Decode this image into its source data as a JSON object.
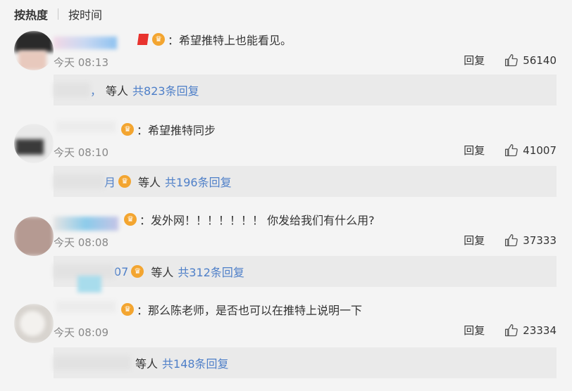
{
  "tabs": {
    "hot": "按热度",
    "time": "按时间"
  },
  "comments": [
    {
      "text": "：希望推特上也能看见。",
      "time": "今天 08:13",
      "reply_label": "回复",
      "likes": "56140",
      "sub": {
        "prefix": "，",
        "others": "等人",
        "link": "共823条回复"
      }
    },
    {
      "text": "：希望推特同步",
      "time": "今天 08:10",
      "reply_label": "回复",
      "likes": "41007",
      "sub": {
        "prefix": "月",
        "others": "等人",
        "link": "共196条回复"
      }
    },
    {
      "text": "：发外网！！！！！！！ 你发给我们有什么用?",
      "time": "今天 08:08",
      "reply_label": "回复",
      "likes": "37333",
      "sub": {
        "prefix": "07",
        "others": "等人",
        "link": "共312条回复"
      }
    },
    {
      "text": "：那么陈老师，是否也可以在推特上说明一下",
      "time": "今天 08:09",
      "reply_label": "回复",
      "likes": "23334",
      "sub": {
        "prefix": "",
        "others": "等人",
        "link": "共148条回复"
      }
    }
  ],
  "icons": {
    "like": "thumbs-up-icon",
    "vip": "crown-badge-icon"
  },
  "colors": {
    "link": "#4e7fc8",
    "time": "#888888",
    "subbox": "#eaeaea",
    "background": "#f4f4f4"
  }
}
